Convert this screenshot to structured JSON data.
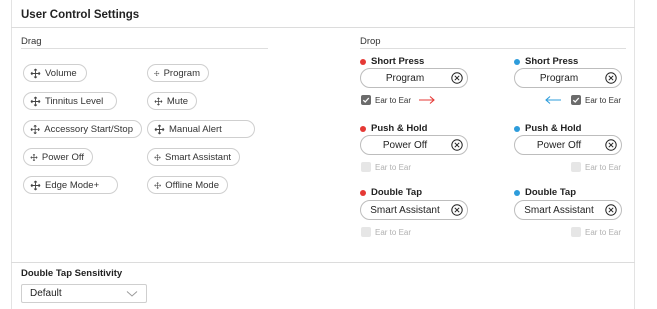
{
  "title": "User Control Settings",
  "drag": {
    "label": "Drag",
    "chips": [
      {
        "label": "Volume"
      },
      {
        "label": "Program"
      },
      {
        "label": "Tinnitus Level"
      },
      {
        "label": "Mute"
      },
      {
        "label": "Accessory Start/Stop"
      },
      {
        "label": "Manual Alert"
      },
      {
        "label": "Power Off"
      },
      {
        "label": "Smart Assistant"
      },
      {
        "label": "Edge Mode+"
      },
      {
        "label": "Offline Mode"
      }
    ]
  },
  "drop": {
    "label": "Drop",
    "colors": {
      "left": "#e53935",
      "right": "#2d9cdb",
      "arrow_right": "#e53935",
      "arrow_left": "#2d9cdb"
    },
    "left": [
      {
        "heading": "Short Press",
        "value": "Program",
        "ear_label": "Ear to Ear",
        "ear_checked": true
      },
      {
        "heading": "Push & Hold",
        "value": "Power Off",
        "ear_label": "Ear to Ear",
        "ear_checked": false
      },
      {
        "heading": "Double Tap",
        "value": "Smart Assistant",
        "ear_label": "Ear to Ear",
        "ear_checked": false
      }
    ],
    "right": [
      {
        "heading": "Short Press",
        "value": "Program",
        "ear_label": "Ear to Ear",
        "ear_checked": true
      },
      {
        "heading": "Push & Hold",
        "value": "Power Off",
        "ear_label": "Ear to Ear",
        "ear_checked": false
      },
      {
        "heading": "Double Tap",
        "value": "Smart Assistant",
        "ear_label": "Ear to Ear",
        "ear_checked": false
      }
    ]
  },
  "sensitivity": {
    "title": "Double Tap Sensitivity",
    "selected": "Default"
  }
}
